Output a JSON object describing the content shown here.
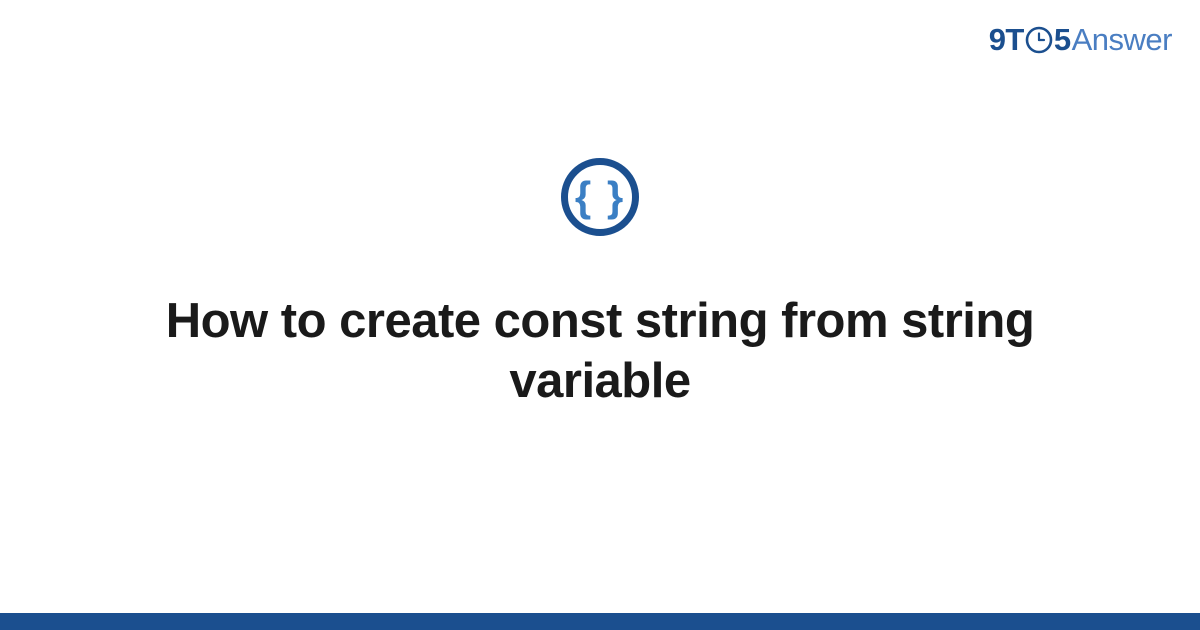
{
  "brand": {
    "part1": "9T",
    "part2": "5",
    "part3": "Answer"
  },
  "icon": {
    "braces": "{ }"
  },
  "main": {
    "title": "How to create const string from string variable"
  },
  "colors": {
    "primary": "#1b4f8f",
    "accent": "#4a7ec2",
    "brace": "#3b7fc4"
  }
}
